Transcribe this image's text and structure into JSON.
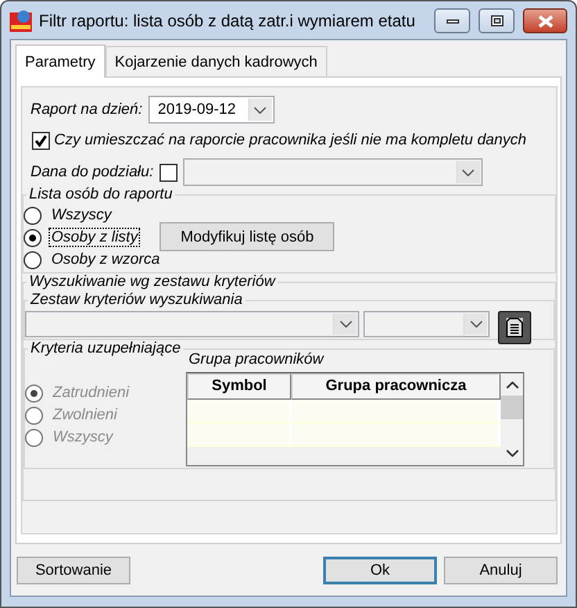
{
  "window": {
    "title": "Filtr raportu: lista osób z datą zatr.i wymiarem etatu"
  },
  "tabs": [
    {
      "label": "Parametry",
      "selected": true
    },
    {
      "label": "Kojarzenie danych kadrowych",
      "selected": false
    }
  ],
  "report_date": {
    "label": "Raport na dzień:",
    "value": "2019-09-12"
  },
  "include_incomplete": {
    "label": "Czy umieszczać na raporcie pracownika jeśli nie ma kompletu danych",
    "checked": true
  },
  "split_field": {
    "label": "Dana do podziału:",
    "checked": false
  },
  "person_list": {
    "title": "Lista osób do raportu",
    "options": [
      {
        "label": "Wszyscy",
        "selected": false,
        "focused": false,
        "disabled": false
      },
      {
        "label": "Osoby z listy",
        "selected": true,
        "focused": true,
        "disabled": false
      },
      {
        "label": "Osoby z wzorca",
        "selected": false,
        "focused": false,
        "disabled": false
      }
    ],
    "modify_button": "Modyfikuj listę osób"
  },
  "search": {
    "title": "Wyszukiwanie wg zestawu kryteriów",
    "criteria_set": {
      "title": "Zestaw kryteriów wyszukiwania"
    },
    "supplementary": {
      "title": "Kryteria uzupełniające",
      "options": [
        {
          "label": "Zatrudnieni",
          "selected": true,
          "focused": false,
          "disabled": true
        },
        {
          "label": "Zwolnieni",
          "selected": false,
          "focused": false,
          "disabled": true
        },
        {
          "label": "Wszyscy",
          "selected": false,
          "focused": false,
          "disabled": true
        }
      ],
      "group_title": "Grupa pracowników",
      "columns": [
        "Symbol",
        "Grupa pracownicza"
      ]
    }
  },
  "buttons": [
    {
      "label": "Sortowanie",
      "default": false
    },
    {
      "label": "Ok",
      "default": true
    },
    {
      "label": "Anuluj",
      "default": false
    }
  ]
}
